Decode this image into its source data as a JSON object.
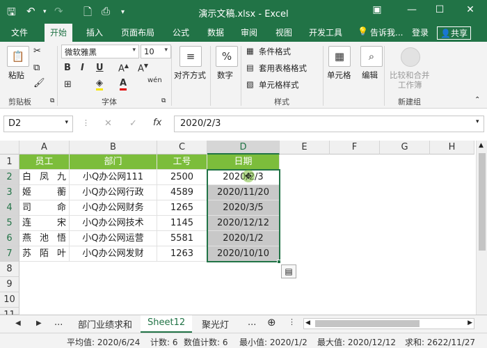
{
  "window": {
    "title": "演示文稿.xlsx - Excel"
  },
  "ribbon_tabs": [
    "文件",
    "开始",
    "插入",
    "页面布局",
    "公式",
    "数据",
    "审阅",
    "视图",
    "开发工具"
  ],
  "tellme": "告诉我...",
  "login": "登录",
  "share": "共享",
  "ribbon": {
    "paste": "粘贴",
    "clipboard": "剪贴板",
    "font_name": "微软雅黑",
    "font_size": "10",
    "font_group": "字体",
    "align": "对齐方式",
    "number": "数字",
    "cond_format": "条件格式",
    "table_format": "套用表格格式",
    "cell_style": "单元格样式",
    "styles": "样式",
    "cells": "单元格",
    "edit": "编辑",
    "compare_merge": "比较和合并",
    "compare_merge2": "工作簿",
    "new_group": "新建组",
    "bold": "B",
    "italic": "I",
    "underline": "U",
    "font_a": "A",
    "percent": "%",
    "fx": "fx"
  },
  "formula_bar": {
    "name_box": "D2",
    "formula": "2020/2/3"
  },
  "columns": [
    "A",
    "B",
    "C",
    "D",
    "E",
    "F",
    "G",
    "H"
  ],
  "rows": [
    "1",
    "2",
    "3",
    "4",
    "5",
    "6",
    "7",
    "8",
    "9",
    "10",
    "11"
  ],
  "table": {
    "headers": [
      "员工",
      "部门",
      "工号",
      "日期"
    ],
    "rows": [
      {
        "name": [
          "白",
          "凤",
          "九"
        ],
        "dept": "小Q办公网111",
        "id": "2500",
        "date": "2020/2/3"
      },
      {
        "name": [
          "姬",
          "",
          "蘅"
        ],
        "dept": "小Q办公网行政",
        "id": "4589",
        "date": "2020/11/20"
      },
      {
        "name": [
          "司",
          "",
          "命"
        ],
        "dept": "小Q办公网财务",
        "id": "1265",
        "date": "2020/3/5"
      },
      {
        "name": [
          "连",
          "",
          "宋"
        ],
        "dept": "小Q办公网技术",
        "id": "1145",
        "date": "2020/12/12"
      },
      {
        "name": [
          "燕",
          "池",
          "悟"
        ],
        "dept": "小Q办公网运营",
        "id": "5581",
        "date": "2020/1/2"
      },
      {
        "name": [
          "苏",
          "陌",
          "叶"
        ],
        "dept": "小Q办公网发财",
        "id": "1263",
        "date": "2020/10/10"
      }
    ]
  },
  "sheets": [
    "部门业绩求和",
    "Sheet12",
    "聚光灯"
  ],
  "sheet_more": "...",
  "status": {
    "avg": "平均值: 2020/6/24",
    "count": "计数: 6",
    "numcount": "数值计数: 6",
    "min": "最小值: 2020/1/2",
    "max": "最大值: 2020/12/12",
    "sum": "求和: 2622/11/27"
  },
  "colors": {
    "brand": "#217346",
    "header_fill": "#7cbd3b",
    "selection": "#c8c8c8"
  }
}
